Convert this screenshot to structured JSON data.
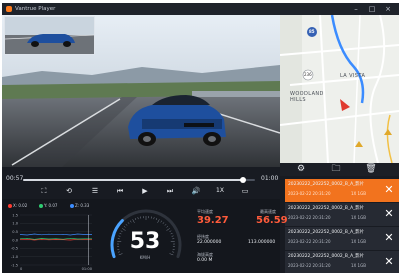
{
  "window": {
    "title": "Vantrue Player"
  },
  "playback": {
    "current_time": "00:57",
    "total_time": "01:00",
    "progress": 0.95,
    "speed": "1X"
  },
  "map": {
    "labels": {
      "highway": "85",
      "route": "236",
      "town1": "LA VISTA",
      "town2": "WOODLAND HILLS"
    }
  },
  "files": [
    {
      "name": "20230222_202252_0002_B_A_影片",
      "date": "2023-02-22 20:31:20",
      "size": "1X 1GB",
      "active": true
    },
    {
      "name": "20230222_202252_0002_B_A_影片",
      "date": "2023-02-22 20:31:20",
      "size": "1X 1GB",
      "active": false
    },
    {
      "name": "20230222_202252_0002_B_A_影片",
      "date": "2023-02-22 20:31:20",
      "size": "1X 1GB",
      "active": false
    },
    {
      "name": "20230222_202252_0002_B_A_影片",
      "date": "2023-02-22 20:31:20",
      "size": "1X 1GB",
      "active": false
    }
  ],
  "gsensor": {
    "legend": [
      "X: 0.02",
      "Y: 0.07",
      "Z: 0.33"
    ],
    "series_colors": [
      "#ff3b30",
      "#2ecc71",
      "#3b8cff"
    ],
    "yticks": [
      "1.5",
      "1.0",
      "0.5",
      "0.0",
      "-0.5",
      "-1.0",
      "-1.5"
    ],
    "xticks": [
      "0",
      "01:00"
    ],
    "chart_data": {
      "type": "line",
      "x": [
        0,
        6,
        12,
        18,
        24,
        30,
        36,
        42,
        48,
        54,
        60
      ],
      "series": [
        {
          "name": "X",
          "values": [
            0.02,
            0.05,
            0.0,
            0.04,
            0.01,
            0.03,
            0.02,
            0.0,
            0.04,
            0.02,
            0.02
          ]
        },
        {
          "name": "Y",
          "values": [
            0.07,
            0.1,
            0.04,
            0.09,
            0.06,
            0.08,
            0.05,
            0.1,
            0.06,
            0.07,
            0.07
          ]
        },
        {
          "name": "Z",
          "values": [
            0.33,
            0.3,
            0.36,
            0.31,
            0.35,
            0.32,
            0.34,
            0.3,
            0.36,
            0.33,
            0.33
          ]
        }
      ],
      "ylim": [
        -1.5,
        1.5
      ]
    }
  },
  "speed": {
    "value": "53",
    "unit": "KM/H",
    "gauge_fraction": 0.3
  },
  "stats": {
    "avg_label": "平均速度",
    "avg_value": "39.27",
    "max_label": "最高速度",
    "max_value": "56.59",
    "coord_label": "经纬度",
    "lat": "22.000000",
    "lon": "113.000000",
    "alt_label": "海拔高度",
    "alt": "0.00 M"
  },
  "colors": {
    "accent": "#f2731e",
    "background": "#181b22"
  }
}
